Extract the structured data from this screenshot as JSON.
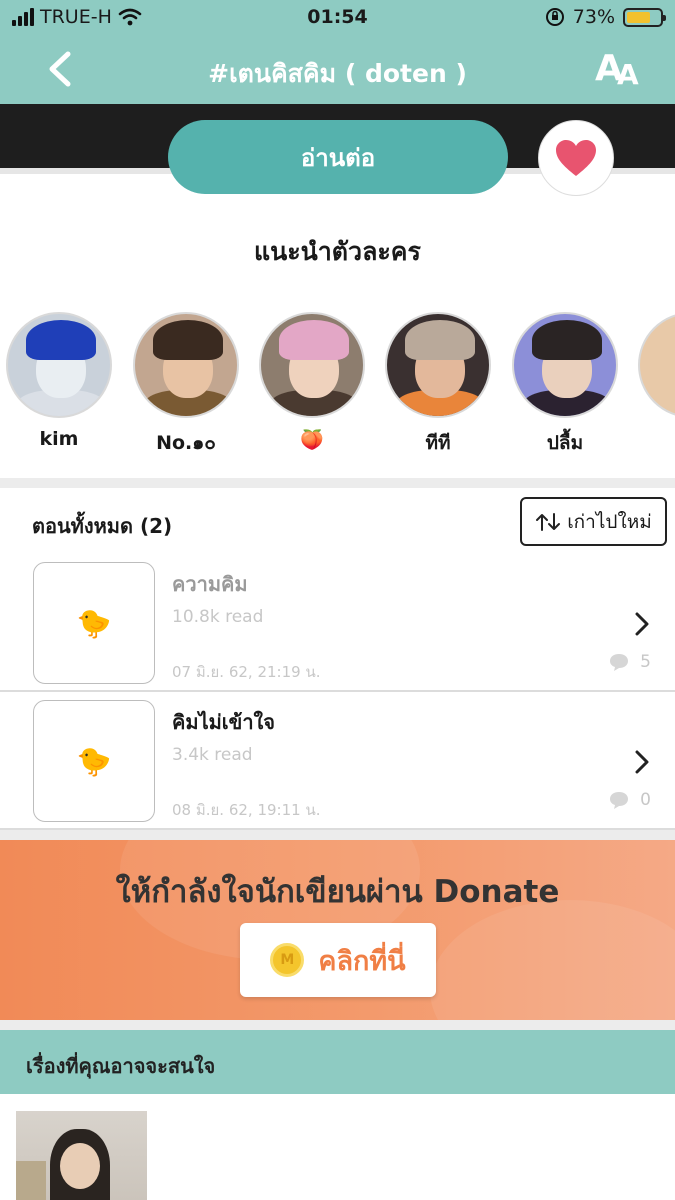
{
  "status_bar": {
    "carrier": "TRUE-H",
    "time": "01:54",
    "battery_percent": "73%",
    "battery_level": 0.73
  },
  "nav": {
    "title": "#เตนคิสคิม ( doten )",
    "font_size_label": "AA"
  },
  "actions": {
    "read_label": "อ่านต่อ"
  },
  "characters": {
    "title": "แนะนำตัวละคร",
    "items": [
      {
        "name": "kim"
      },
      {
        "name": "No.๑๐"
      },
      {
        "name": "🍑"
      },
      {
        "name": "ทีที"
      },
      {
        "name": "ปลื้ม"
      }
    ]
  },
  "episodes": {
    "header": "ตอนทั้งหมด (2)",
    "sort_label": "เก่าไปใหม่",
    "items": [
      {
        "title": "ความคิม",
        "reads": "10.8k read",
        "date": "07 มิ.ย. 62, 21:19 น.",
        "comments": "5",
        "thumb_icon": "🐤",
        "title_color": "#9a9a9a"
      },
      {
        "title": "คิมไม่เข้าใจ",
        "reads": "3.4k read",
        "date": "08 มิ.ย. 62, 19:11 น.",
        "comments": "0",
        "thumb_icon": "🐤",
        "title_color": "#1a1a1a"
      }
    ]
  },
  "donate": {
    "text": "ให้กำลังใจนักเขียนผ่าน Donate",
    "button_label": "คลิกที่นี่",
    "coin_letter": "M"
  },
  "recommend": {
    "title": "เรื่องที่คุณอาจจะสนใจ"
  },
  "colors": {
    "accent": "#8ecbc2",
    "read_button": "#55b2ad",
    "heart": "#e8546f",
    "donate": "#f18a57"
  }
}
